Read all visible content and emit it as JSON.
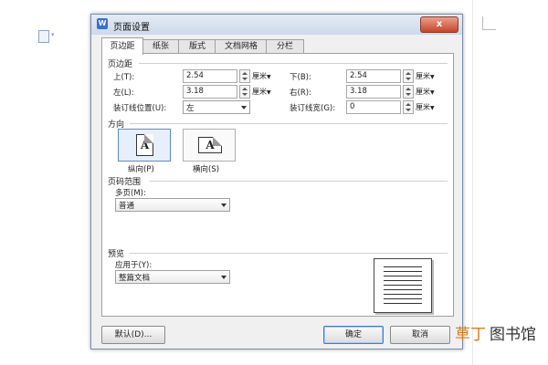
{
  "dialog": {
    "title": "页面设置",
    "close": "x"
  },
  "tabs": [
    "页边距",
    "纸张",
    "版式",
    "文档网格",
    "分栏"
  ],
  "margins": {
    "section": "页边距",
    "top_label": "上(T):",
    "top_value": "2.54",
    "bottom_label": "下(B):",
    "bottom_value": "2.54",
    "left_label": "左(L):",
    "left_value": "3.18",
    "right_label": "右(R):",
    "right_value": "3.18",
    "gutter_pos_label": "装订线位置(U):",
    "gutter_pos_value": "左",
    "gutter_width_label": "装订线宽(G):",
    "gutter_width_value": "0",
    "unit": "厘米"
  },
  "orientation": {
    "section": "方向",
    "portrait": "纵向(P)",
    "landscape": "横向(S)",
    "glyph": "A"
  },
  "pages": {
    "section": "页码范围",
    "multi_label": "多页(M):",
    "multi_value": "普通"
  },
  "preview": {
    "section": "预览",
    "apply_label": "应用于(Y):",
    "apply_value": "整篇文档"
  },
  "buttons": {
    "default": "默认(D)...",
    "ok": "确定",
    "cancel": "取消"
  },
  "watermark": {
    "part1": "草丁",
    "part2": "图书馆"
  }
}
